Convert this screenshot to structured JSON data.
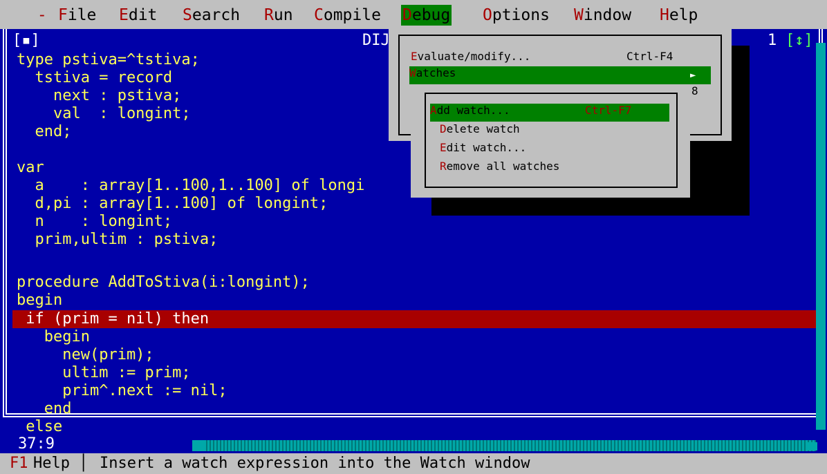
{
  "menubar": {
    "items": [
      {
        "pre": " ",
        "hot": "-",
        "post": " "
      },
      {
        "pre": "",
        "hot": "F",
        "post": "ile"
      },
      {
        "pre": "",
        "hot": "E",
        "post": "dit"
      },
      {
        "pre": "",
        "hot": "S",
        "post": "earch"
      },
      {
        "pre": "",
        "hot": "R",
        "post": "un"
      },
      {
        "pre": "",
        "hot": "C",
        "post": "ompile"
      },
      {
        "pre": "",
        "hot": "D",
        "post": "ebug"
      },
      {
        "pre": "",
        "hot": "O",
        "post": "ptions"
      },
      {
        "pre": "",
        "hot": "W",
        "post": "indow"
      },
      {
        "pre": "",
        "hot": "H",
        "post": "elp"
      }
    ]
  },
  "editor": {
    "title": "DIJ",
    "window_number": "1",
    "close_glyph": "[▪]",
    "zoom_glyph": "[↕]",
    "position": "37:9",
    "code": [
      "type pstiva=^tstiva;",
      "  tstiva = record",
      "    next : pstiva;",
      "    val  : longint;",
      "  end;",
      "",
      "var",
      "  a    : array[1..100,1..100] of longi",
      "  d,pi : array[1..100] of longint;",
      "  n    : longint;",
      "  prim,ultim : pstiva;",
      "",
      "procedure AddToStiva(i:longint);",
      "begin",
      " if (prim = nil) then",
      "   begin",
      "     new(prim);",
      "     ultim := prim;",
      "     prim^.next := nil;",
      "   end",
      " else"
    ]
  },
  "debug_menu": {
    "items": [
      {
        "hot": "E",
        "rest": "valuate/modify...",
        "shortcut": "Ctrl-F4"
      },
      {
        "hot": "W",
        "rest": "atches",
        "shortcut": "►"
      }
    ],
    "hidden_digit": "8"
  },
  "watches_submenu": {
    "items": [
      {
        "hot": "A",
        "rest": "dd watch...",
        "shortcut": "Ctrl-F7"
      },
      {
        "hot": "D",
        "rest": "elete watch",
        "shortcut": ""
      },
      {
        "hot": "E",
        "rest": "dit watch...",
        "shortcut": ""
      },
      {
        "hot": "R",
        "rest": "emove all watches",
        "shortcut": ""
      }
    ]
  },
  "status": {
    "key": "F1",
    "key_label": "Help",
    "separator": "│",
    "hint": "Insert a watch expression into the Watch window"
  },
  "colors": {
    "background": "#0000a8",
    "code_text": "#ffff55",
    "highlight_line": "#a80000",
    "menu_bg": "#c0c0c0",
    "menu_selected": "#008000",
    "hotkey": "#a80000"
  }
}
